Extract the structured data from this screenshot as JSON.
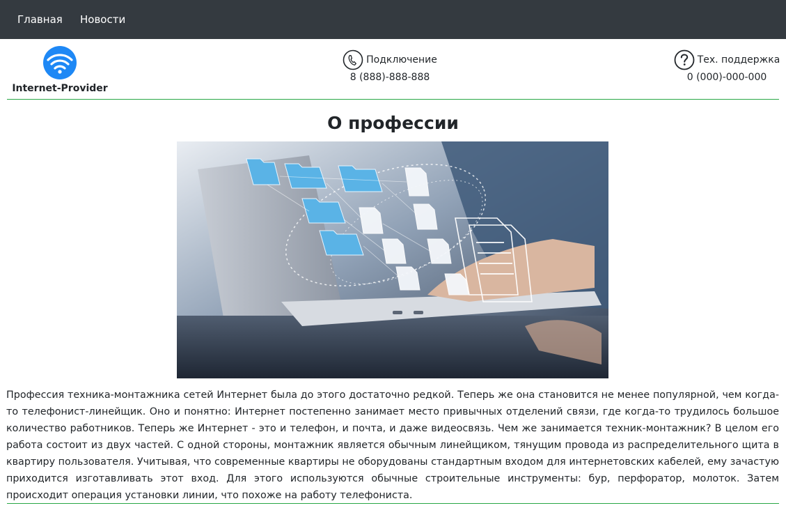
{
  "nav": {
    "items": [
      {
        "label": "Главная"
      },
      {
        "label": "Новости"
      }
    ]
  },
  "header": {
    "brand_name": "Internet-Provider",
    "connection": {
      "label": "Подключение",
      "phone": "8 (888)-888-888",
      "icon": "phone-icon"
    },
    "support": {
      "label": "Тех. поддержка",
      "phone": "0 (000)-000-000",
      "icon": "question-icon"
    }
  },
  "main": {
    "title": "О профессии",
    "article": "Профессия техника-монтажника сетей Интернет была до этого достаточно редкой. Теперь же она становится не менее популярной, чем когда-то телефонист-линейщик. Оно и понятно: Интернет постепенно занимает место привычных отделений связи, где когда-то трудилось большое количество работников. Теперь же Интернет - это и телефон, и почта, и даже видеосвязь. Чем же занимается техник-монтажник? В целом его работа состоит из двух частей. С одной стороны, монтажник является обычным линейщиком, тянущим провода из распределительного щита в квартиру пользователя. Учитывая, что современные квартиры не оборудованы стандартным входом для интернетовских кабелей, ему зачастую приходится изготавливать этот вход. Для этого используются обычные строительные инструменты: бур, перфоратор, молоток. Затем происходит операция установки линии, что похоже на работу телефониста."
  },
  "colors": {
    "navbar_bg": "#343a40",
    "divider": "#28a745",
    "logo_blue": "#1e88f5"
  }
}
